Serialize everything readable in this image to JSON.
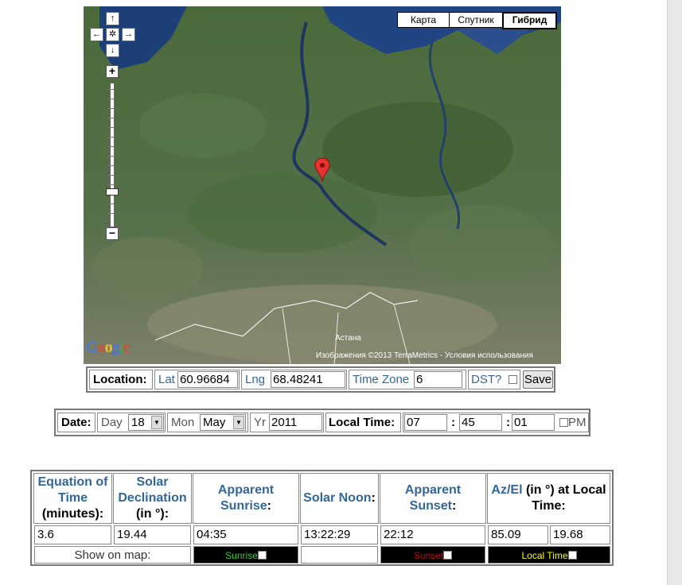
{
  "map": {
    "types": [
      "Карта",
      "Спутник",
      "Гибрид"
    ],
    "active_type": "Гибрид",
    "google_logo": "Google",
    "copyright": "Изображения ©2013 TerraMetrics - Условия использования",
    "city_label": "Астана",
    "pan_icons": {
      "up": "↑",
      "left": "←",
      "center": "✲",
      "right": "→",
      "down": "↓"
    },
    "zoom_in": "+",
    "zoom_out": "−"
  },
  "location": {
    "label": "Location:",
    "lat_label": "Lat",
    "lat_value": "60.96684",
    "lng_label": "Lng",
    "lng_value": "68.48241",
    "tz_label": "Time Zone",
    "tz_value": "6",
    "dst_label": "DST?",
    "save_label": "Save"
  },
  "date": {
    "label": "Date:",
    "day_label": "Day",
    "day_value": "18",
    "mon_label": "Mon",
    "mon_value": "May",
    "yr_label": "Yr",
    "yr_value": "2011",
    "time_label": "Local Time:",
    "hour": "07",
    "minute": "45",
    "second": "01",
    "sep": ":",
    "pm_label": "PM"
  },
  "results": {
    "headers": {
      "eot": {
        "blue": "Equation of Time",
        "rest": "(minutes):"
      },
      "decl": {
        "blue": "Solar Declination",
        "rest": "(in °):"
      },
      "sunrise": {
        "blue": "Apparent Sunrise",
        "rest": ":"
      },
      "noon": {
        "blue": "Solar Noon",
        "rest": ":"
      },
      "sunset": {
        "blue": "Apparent Sunset",
        "rest": ":"
      },
      "azel": {
        "blue": "Az/El",
        "rest": "(in °) at Local Time:"
      }
    },
    "values": {
      "eot": "3.6",
      "decl": "19.44",
      "sunrise": "04:35",
      "noon": "13:22:29",
      "sunset": "22:12",
      "az": "85.09",
      "el": "19.68"
    },
    "show_on_map": "Show on map:",
    "toggles": {
      "sunrise": "Sunrise",
      "sunset": "Sunset",
      "localtime": "Local Time"
    },
    "toggle_colors": {
      "sunrise": "#33cc33",
      "sunset": "#cc0000",
      "localtime": "#ffff00"
    }
  }
}
